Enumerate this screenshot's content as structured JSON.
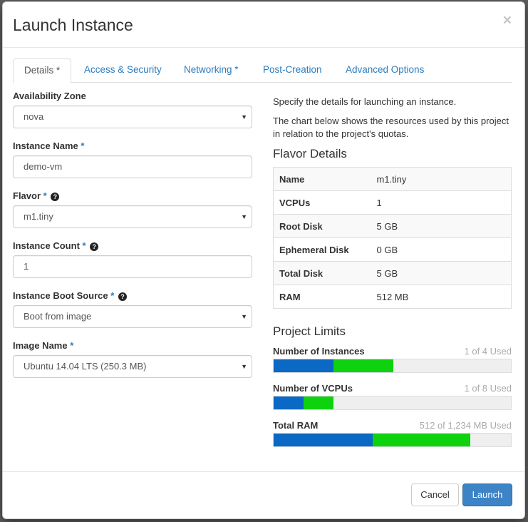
{
  "dialog": {
    "title": "Launch Instance",
    "close_symbol": "×"
  },
  "tabs": [
    {
      "label": "Details *"
    },
    {
      "label": "Access & Security"
    },
    {
      "label": "Networking *"
    },
    {
      "label": "Post-Creation"
    },
    {
      "label": "Advanced Options"
    }
  ],
  "form": {
    "availability_zone": {
      "label": "Availability Zone",
      "value": "nova"
    },
    "instance_name": {
      "label": "Instance Name",
      "required_mark": "*",
      "value": "demo-vm"
    },
    "flavor": {
      "label": "Flavor",
      "required_mark": "*",
      "help_icon": "?",
      "value": "m1.tiny"
    },
    "instance_count": {
      "label": "Instance Count",
      "required_mark": "*",
      "help_icon": "?",
      "value": "1"
    },
    "boot_source": {
      "label": "Instance Boot Source",
      "required_mark": "*",
      "help_icon": "?",
      "value": "Boot from image"
    },
    "image_name": {
      "label": "Image Name",
      "required_mark": "*",
      "value": "Ubuntu 14.04 LTS (250.3 MB)"
    }
  },
  "info": {
    "intro": "Specify the details for launching an instance.",
    "chart_note": "The chart below shows the resources used by this project in relation to the project's quotas."
  },
  "flavor_details": {
    "title": "Flavor Details",
    "rows": [
      {
        "key": "Name",
        "value": "m1.tiny"
      },
      {
        "key": "VCPUs",
        "value": "1"
      },
      {
        "key": "Root Disk",
        "value": "5 GB"
      },
      {
        "key": "Ephemeral Disk",
        "value": "0 GB"
      },
      {
        "key": "Total Disk",
        "value": "5 GB"
      },
      {
        "key": "RAM",
        "value": "512 MB"
      }
    ]
  },
  "project_limits": {
    "title": "Project Limits",
    "items": [
      {
        "label": "Number of Instances",
        "used_text": "1 of 4 Used",
        "used_fraction": 0.25,
        "added_fraction": 0.25
      },
      {
        "label": "Number of VCPUs",
        "used_text": "1 of 8 Used",
        "used_fraction": 0.125,
        "added_fraction": 0.125
      },
      {
        "label": "Total RAM",
        "used_text": "512 of 1,234 MB Used",
        "used_fraction": 0.415,
        "added_fraction": 0.41
      }
    ]
  },
  "footer": {
    "cancel_label": "Cancel",
    "launch_label": "Launch"
  },
  "colors": {
    "used_bar": "#0b68c4",
    "new_bar": "#0fd20f",
    "primary_button": "#3c84c6",
    "link": "#2a7bbd"
  }
}
